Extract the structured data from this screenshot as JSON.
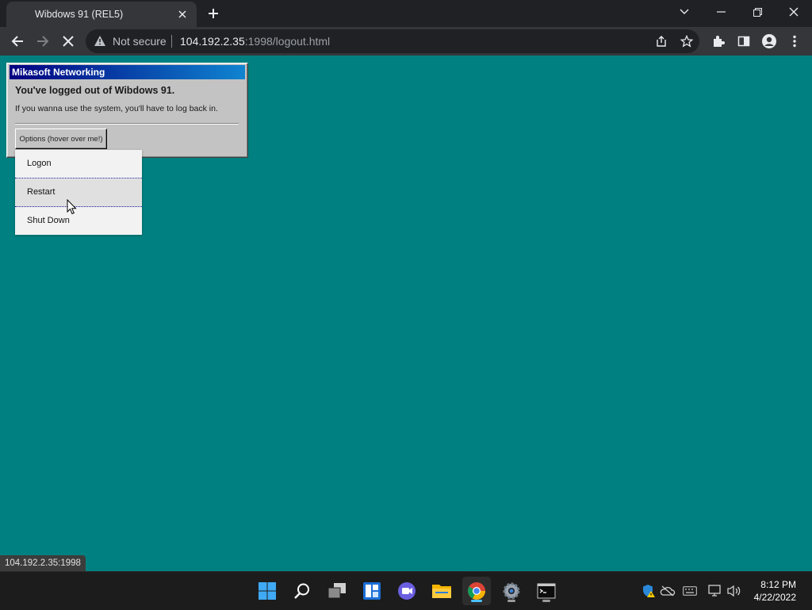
{
  "browser": {
    "tab_title": "Wibdows 91 (REL5)",
    "security_label": "Not secure",
    "url_host": "104.192.2.35",
    "url_rest": ":1998/logout.html",
    "status_url": "104.192.2.35:1998"
  },
  "dialog": {
    "title": "Mikasoft Networking",
    "heading": "You've logged out of Wibdows 91.",
    "message": "If you wanna use the system, you'll have to log back in.",
    "options_label": "Options (hover over me!)",
    "menu_items": [
      "Logon",
      "Restart",
      "Shut Down"
    ],
    "hovered_item": "Restart"
  },
  "taskbar": {
    "time": "8:12 PM",
    "date": "4/22/2022",
    "apps": [
      "start-icon",
      "search-icon",
      "task-view-icon",
      "widgets-icon",
      "chat-icon",
      "file-explorer-icon",
      "chrome-icon",
      "settings-icon",
      "terminal-icon"
    ]
  },
  "colors": {
    "desktop": "#008080",
    "titlebar_start": "#000080",
    "titlebar_end": "#1084d0",
    "dialog_face": "#c3c3c3"
  }
}
